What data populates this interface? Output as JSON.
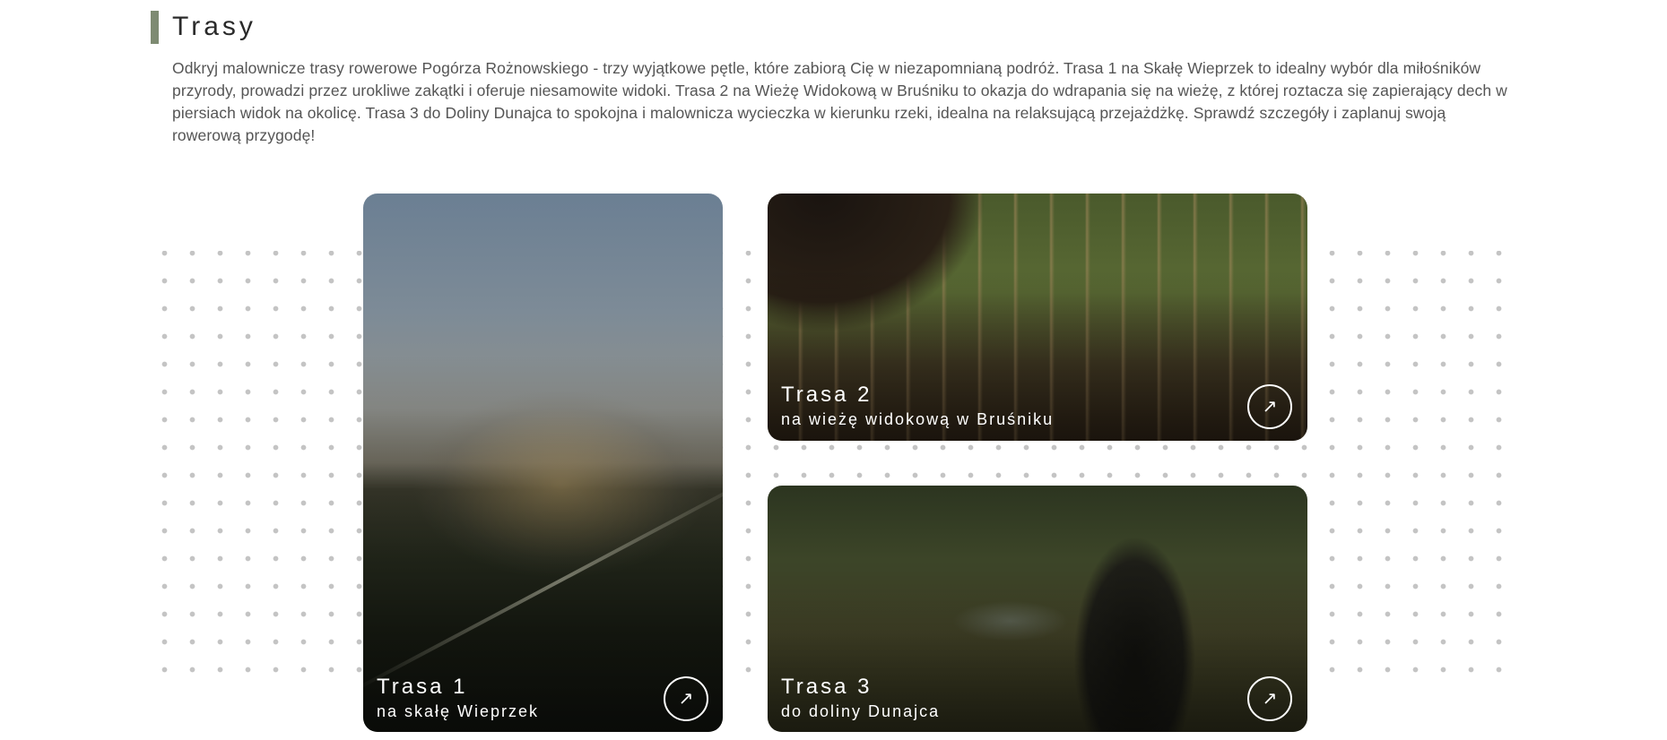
{
  "section": {
    "title": "Trasy",
    "intro": "Odkryj malownicze trasy rowerowe Pogórza Rożnowskiego - trzy wyjątkowe pętle, które zabiorą Cię w niezapomnianą podróż. Trasa 1 na Skałę Wieprzek to idealny wybór dla miłośników przyrody, prowadzi przez urokliwe zakątki i oferuje niesamowite widoki. Trasa 2 na Wieżę Widokową w Bruśniku to okazja do wdrapania się na wieżę, z której roztacza się zapierający dech w piersiach widok na okolicę. Trasa 3 do Doliny Dunajca to spokojna i malownicza wycieczka w kierunku rzeki, idealna na relaksującą przejażdżkę. Sprawdź szczegóły i zaplanuj swoją rowerową przygodę!"
  },
  "routes": [
    {
      "title": "Trasa 1",
      "subtitle": "na skałę Wieprzek",
      "icon": "arrow-up-right-icon"
    },
    {
      "title": "Trasa 2",
      "subtitle": "na wieżę widokową w Bruśniku",
      "icon": "arrow-up-right-icon"
    },
    {
      "title": "Trasa 3",
      "subtitle": "do doliny Dunajca",
      "icon": "arrow-up-right-icon"
    }
  ],
  "colors": {
    "accent": "#7e8b72",
    "dots": "#c4c4c4",
    "text": "#555555"
  }
}
